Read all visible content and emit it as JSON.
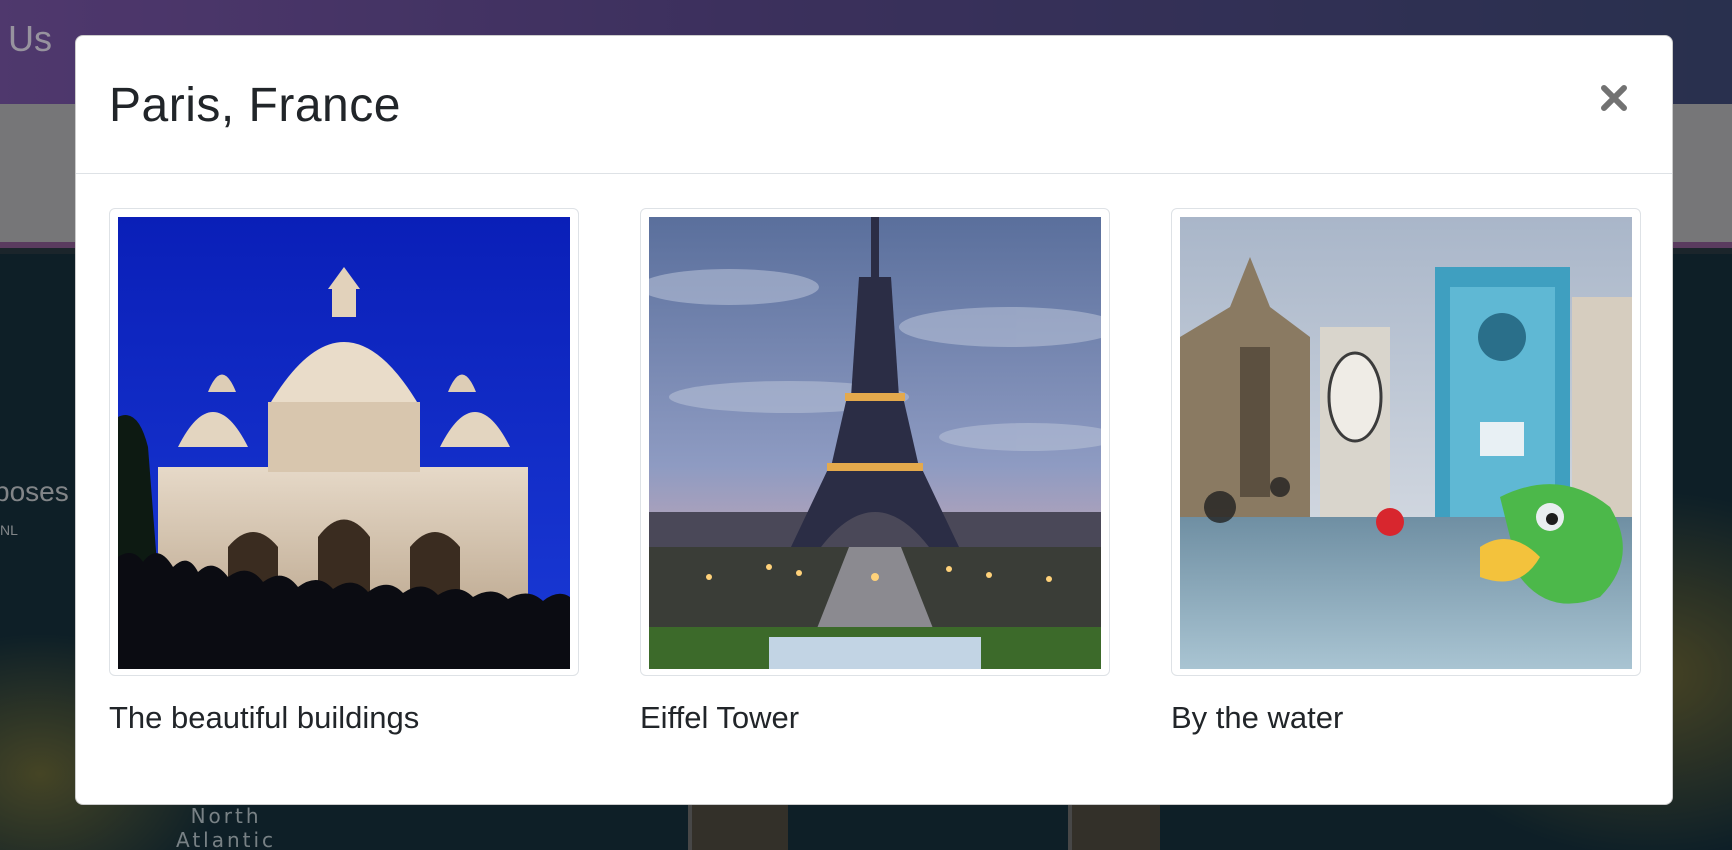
{
  "background": {
    "nav_text": "t Us",
    "side_text": "poses",
    "side_sub": "NL",
    "map_label_line1": "North",
    "map_label_line2": "Atlantic"
  },
  "modal": {
    "title": "Paris, France",
    "close_icon": "close-icon",
    "photos": [
      {
        "caption": "The beautiful buildings",
        "image": "sacre-coeur-basilica"
      },
      {
        "caption": "Eiffel Tower",
        "image": "eiffel-tower-dusk"
      },
      {
        "caption": "By the water",
        "image": "stravinsky-fountain-murals"
      }
    ]
  }
}
